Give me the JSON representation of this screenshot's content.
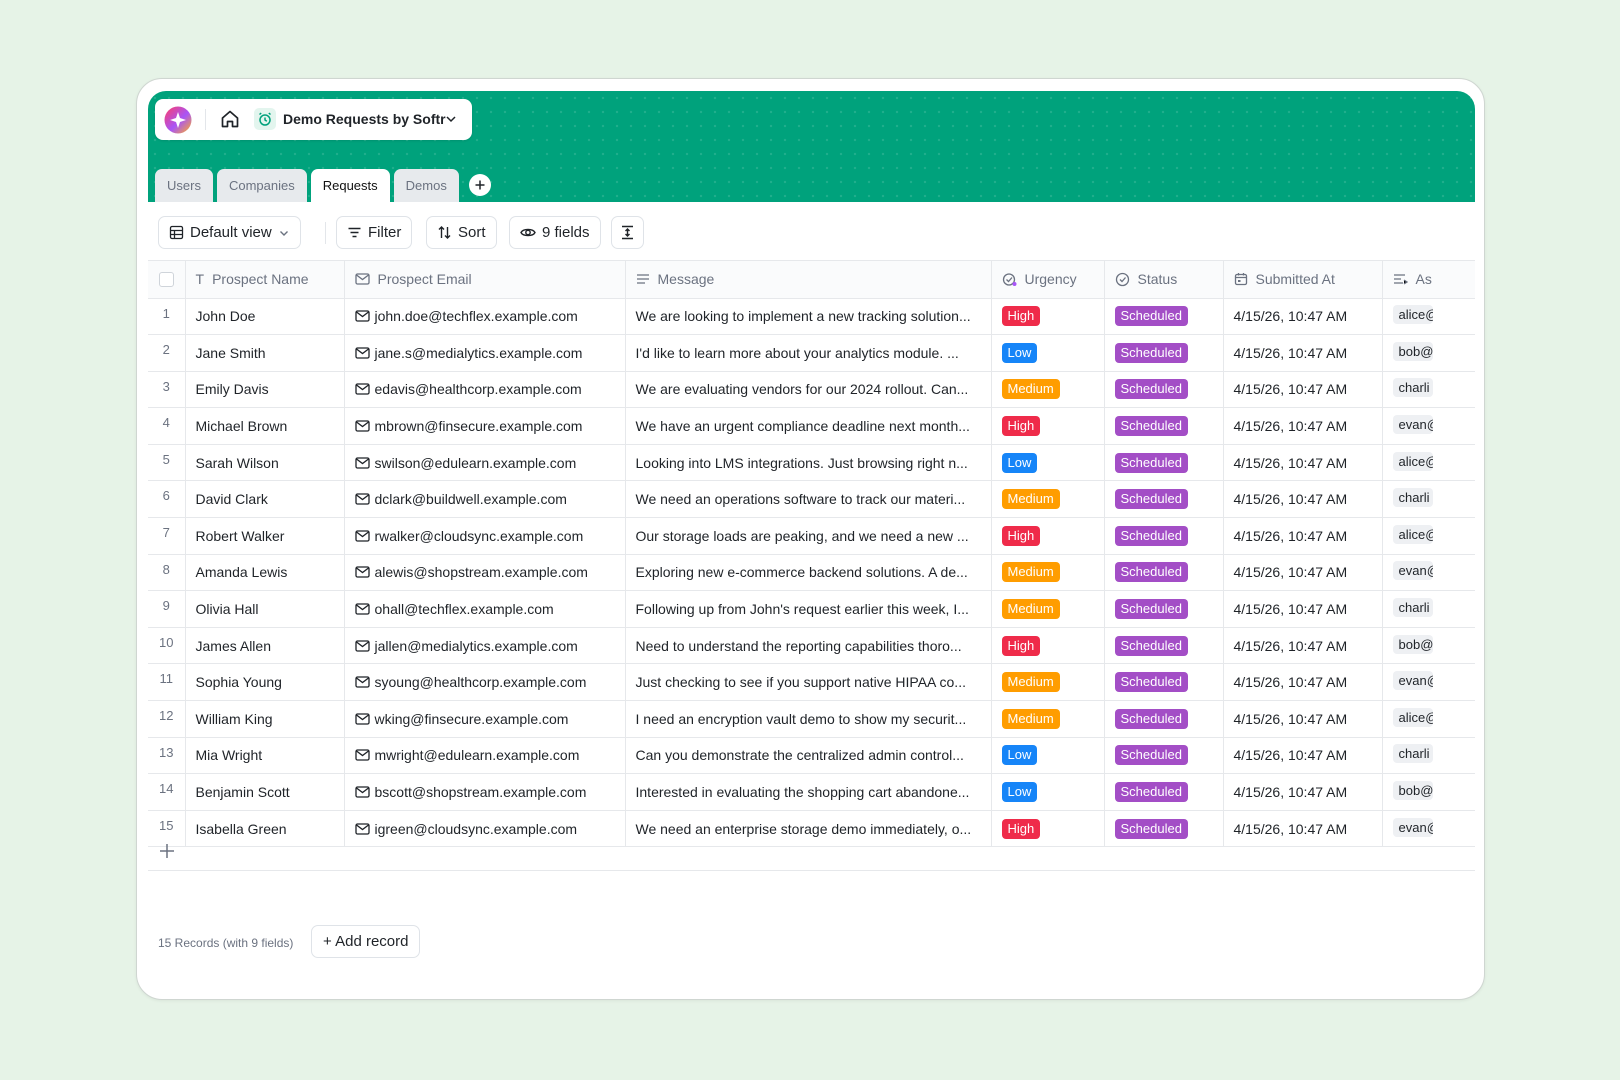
{
  "app": {
    "db_title": "Demo Requests by Softr",
    "logo_colors": [
      "#ff3d68",
      "#a855f7",
      "#ffb020"
    ]
  },
  "tabs": [
    {
      "label": "Users",
      "active": false
    },
    {
      "label": "Companies",
      "active": false
    },
    {
      "label": "Requests",
      "active": true
    },
    {
      "label": "Demos",
      "active": false
    }
  ],
  "toolbar": {
    "view_label": "Default view",
    "filter_label": "Filter",
    "sort_label": "Sort",
    "fields_label": "9 fields"
  },
  "columns": [
    {
      "label": "Prospect Name",
      "icon": "text-icon"
    },
    {
      "label": "Prospect Email",
      "icon": "mail-icon"
    },
    {
      "label": "Message",
      "icon": "long-text-icon"
    },
    {
      "label": "Urgency",
      "icon": "urgency-icon"
    },
    {
      "label": "Status",
      "icon": "status-icon"
    },
    {
      "label": "Submitted At",
      "icon": "calendar-icon"
    },
    {
      "label": "As",
      "icon": "assignee-icon"
    }
  ],
  "urgency_colors": {
    "High": "#ef2b4a",
    "Low": "#1685f8",
    "Medium": "#ff9d00"
  },
  "status_color": "#a34ec6",
  "rows": [
    {
      "n": "1",
      "name": "John Doe",
      "email": "john.doe@techflex.example.com",
      "message": "We are looking to implement a new tracking solution...",
      "urgency": "High",
      "status": "Scheduled",
      "submitted": "4/15/26, 10:47 AM",
      "assignee": "alice@"
    },
    {
      "n": "2",
      "name": "Jane Smith",
      "email": "jane.s@medialytics.example.com",
      "message": "I'd like to learn more about your analytics module. ...",
      "urgency": "Low",
      "status": "Scheduled",
      "submitted": "4/15/26, 10:47 AM",
      "assignee": "bob@"
    },
    {
      "n": "3",
      "name": "Emily Davis",
      "email": "edavis@healthcorp.example.com",
      "message": "We are evaluating vendors for our 2024 rollout. Can...",
      "urgency": "Medium",
      "status": "Scheduled",
      "submitted": "4/15/26, 10:47 AM",
      "assignee": "charli"
    },
    {
      "n": "4",
      "name": "Michael Brown",
      "email": "mbrown@finsecure.example.com",
      "message": "We have an urgent compliance deadline next month...",
      "urgency": "High",
      "status": "Scheduled",
      "submitted": "4/15/26, 10:47 AM",
      "assignee": "evan@"
    },
    {
      "n": "5",
      "name": "Sarah Wilson",
      "email": "swilson@edulearn.example.com",
      "message": "Looking into LMS integrations. Just browsing right n...",
      "urgency": "Low",
      "status": "Scheduled",
      "submitted": "4/15/26, 10:47 AM",
      "assignee": "alice@"
    },
    {
      "n": "6",
      "name": "David Clark",
      "email": "dclark@buildwell.example.com",
      "message": "We need an operations software to track our materi...",
      "urgency": "Medium",
      "status": "Scheduled",
      "submitted": "4/15/26, 10:47 AM",
      "assignee": "charli"
    },
    {
      "n": "7",
      "name": "Robert Walker",
      "email": "rwalker@cloudsync.example.com",
      "message": "Our storage loads are peaking, and we need a new ...",
      "urgency": "High",
      "status": "Scheduled",
      "submitted": "4/15/26, 10:47 AM",
      "assignee": "alice@"
    },
    {
      "n": "8",
      "name": "Amanda Lewis",
      "email": "alewis@shopstream.example.com",
      "message": "Exploring new e-commerce backend solutions. A de...",
      "urgency": "Medium",
      "status": "Scheduled",
      "submitted": "4/15/26, 10:47 AM",
      "assignee": "evan@"
    },
    {
      "n": "9",
      "name": "Olivia Hall",
      "email": "ohall@techflex.example.com",
      "message": "Following up from John's request earlier this week, I...",
      "urgency": "Medium",
      "status": "Scheduled",
      "submitted": "4/15/26, 10:47 AM",
      "assignee": "charli"
    },
    {
      "n": "10",
      "name": "James Allen",
      "email": "jallen@medialytics.example.com",
      "message": "Need to understand the reporting capabilities thoro...",
      "urgency": "High",
      "status": "Scheduled",
      "submitted": "4/15/26, 10:47 AM",
      "assignee": "bob@"
    },
    {
      "n": "11",
      "name": "Sophia Young",
      "email": "syoung@healthcorp.example.com",
      "message": "Just checking to see if you support native HIPAA co...",
      "urgency": "Medium",
      "status": "Scheduled",
      "submitted": "4/15/26, 10:47 AM",
      "assignee": "evan@"
    },
    {
      "n": "12",
      "name": "William King",
      "email": "wking@finsecure.example.com",
      "message": "I need an encryption vault demo to show my securit...",
      "urgency": "Medium",
      "status": "Scheduled",
      "submitted": "4/15/26, 10:47 AM",
      "assignee": "alice@"
    },
    {
      "n": "13",
      "name": "Mia Wright",
      "email": "mwright@edulearn.example.com",
      "message": "Can you demonstrate the centralized admin control...",
      "urgency": "Low",
      "status": "Scheduled",
      "submitted": "4/15/26, 10:47 AM",
      "assignee": "charli"
    },
    {
      "n": "14",
      "name": "Benjamin Scott",
      "email": "bscott@shopstream.example.com",
      "message": "Interested in evaluating the shopping cart abandone...",
      "urgency": "Low",
      "status": "Scheduled",
      "submitted": "4/15/26, 10:47 AM",
      "assignee": "bob@"
    },
    {
      "n": "15",
      "name": "Isabella Green",
      "email": "igreen@cloudsync.example.com",
      "message": "We need an enterprise storage demo immediately, o...",
      "urgency": "High",
      "status": "Scheduled",
      "submitted": "4/15/26, 10:47 AM",
      "assignee": "evan@"
    }
  ],
  "footer": {
    "records_info": "15 Records (with 9 fields)",
    "add_record_label": "+ Add record"
  }
}
